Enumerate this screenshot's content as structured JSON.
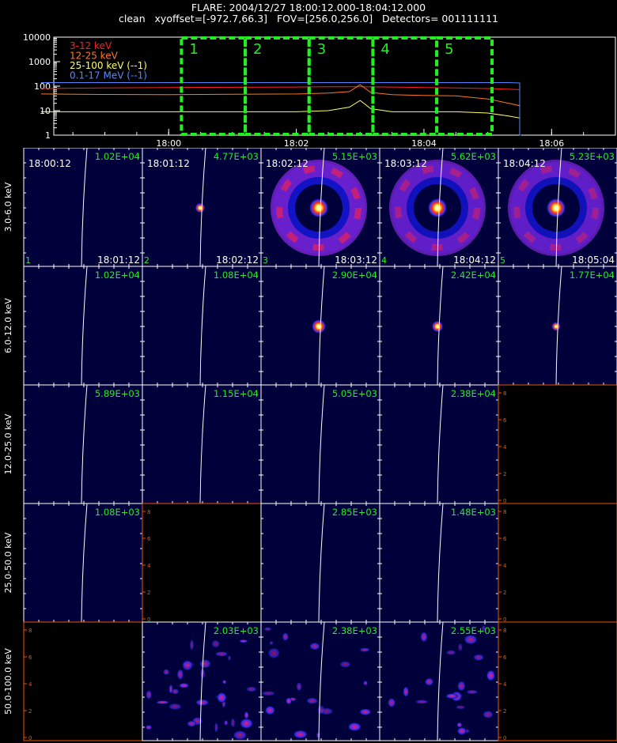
{
  "header": {
    "line1": "FLARE: 2004/12/27 18:00:12.000-18:04:12.000",
    "line2": "clean   xyoffset=[-972.7,66.3]   FOV=[256.0,256.0]   Detectors= 001111111"
  },
  "colors": {
    "bg": "#000000",
    "axis": "#ffffff",
    "green": "#22ee22",
    "orange_axis": "#ee5500",
    "red": "#ff2020",
    "orange": "#ff7722",
    "yellow": "#ffff66",
    "blue": "#5588ff",
    "panel_fill": "#00003a",
    "limb": "#ffffff"
  },
  "chart_data": [
    {
      "type": "line",
      "y_scale": "log",
      "ylim": [
        1,
        10000
      ],
      "y_ticks": [
        "10000",
        "1000",
        "100",
        "10",
        "1"
      ],
      "x_ticks": [
        "18:00",
        "18:02",
        "18:04",
        "18:06"
      ],
      "series": [
        {
          "name": "3-12 keV",
          "color": "#ff2020",
          "x": [
            "17:58:00",
            "17:59:00",
            "18:00:00",
            "18:01:00",
            "18:02:00",
            "18:02:30",
            "18:03:00",
            "18:03:30",
            "18:04:00",
            "18:04:30",
            "18:05:00",
            "18:05:20",
            "18:05:30"
          ],
          "values": [
            80,
            85,
            88,
            90,
            92,
            95,
            95,
            92,
            88,
            85,
            80,
            75,
            72
          ]
        },
        {
          "name": "12-25 keV",
          "color": "#ff7722",
          "x": [
            "17:58:00",
            "17:59:00",
            "18:00:00",
            "18:01:00",
            "18:02:00",
            "18:02:30",
            "18:02:50",
            "18:03:00",
            "18:03:10",
            "18:03:30",
            "18:04:00",
            "18:04:30",
            "18:05:00",
            "18:05:20",
            "18:05:30"
          ],
          "values": [
            48,
            46,
            45,
            47,
            48,
            52,
            60,
            115,
            55,
            45,
            42,
            40,
            30,
            20,
            16
          ]
        },
        {
          "name": "25-100 keV (--1)",
          "color": "#ffff66",
          "x": [
            "17:58:00",
            "17:59:00",
            "18:00:00",
            "18:01:00",
            "18:02:00",
            "18:02:30",
            "18:02:50",
            "18:03:00",
            "18:03:10",
            "18:03:30",
            "18:04:00",
            "18:04:30",
            "18:05:00",
            "18:05:20",
            "18:05:30"
          ],
          "values": [
            9,
            9,
            9,
            9,
            9,
            10,
            14,
            26,
            12,
            9,
            9,
            9,
            8,
            6,
            5
          ]
        },
        {
          "name": "0.1-17 MeV (--1)",
          "color": "#5588ff",
          "x": [
            "17:58:00",
            "17:59:00",
            "18:00:00",
            "18:01:00",
            "18:02:00",
            "18:03:00",
            "18:04:00",
            "18:05:00",
            "18:05:20",
            "18:05:30"
          ],
          "values": [
            140,
            140,
            140,
            140,
            140,
            140,
            140,
            140,
            140,
            135
          ]
        }
      ],
      "intervals": [
        {
          "label": "1",
          "start": "18:00:12",
          "end": "18:01:12"
        },
        {
          "label": "2",
          "start": "18:01:12",
          "end": "18:02:12"
        },
        {
          "label": "3",
          "start": "18:02:12",
          "end": "18:03:12"
        },
        {
          "label": "4",
          "start": "18:03:12",
          "end": "18:04:12"
        },
        {
          "label": "5",
          "start": "18:04:12",
          "end": "18:05:04"
        }
      ]
    },
    {
      "type": "heatmap",
      "rows": [
        "3.0-6.0 keV",
        "6.0-12.0 keV",
        "12.0-25.0 keV",
        "25.0-50.0 keV",
        "50.0-100.0 keV"
      ],
      "columns": [
        {
          "label": "1",
          "start": "18:00:12",
          "end": "18:01:12"
        },
        {
          "label": "2",
          "start": "18:01:12",
          "end": "18:02:12"
        },
        {
          "label": "3",
          "start": "18:02:12",
          "end": "18:03:12"
        },
        {
          "label": "4",
          "start": "18:03:12",
          "end": "18:04:12"
        },
        {
          "label": "5",
          "start": "18:04:12",
          "end": "18:05:04"
        }
      ],
      "axis_ticks": [
        "0",
        "2",
        "4",
        "6",
        "8"
      ],
      "cells": [
        [
          {
            "max": "1.02E+04",
            "state": "empty"
          },
          {
            "max": "4.77E+03",
            "state": "point",
            "source_strength": 0.35
          },
          {
            "max": "5.15E+03",
            "state": "ring",
            "ring_strength": 0.6
          },
          {
            "max": "5.62E+03",
            "state": "ring",
            "ring_strength": 0.45
          },
          {
            "max": "5.23E+03",
            "state": "ring",
            "ring_strength": 0.4
          }
        ],
        [
          {
            "max": "1.02E+04",
            "state": "empty"
          },
          {
            "max": "1.08E+04",
            "state": "empty"
          },
          {
            "max": "2.90E+04",
            "state": "point",
            "source_strength": 0.8
          },
          {
            "max": "2.42E+04",
            "state": "point",
            "source_strength": 0.5
          },
          {
            "max": "1.77E+04",
            "state": "point",
            "source_strength": 0.25
          }
        ],
        [
          {
            "max": "5.89E+03",
            "state": "empty"
          },
          {
            "max": "1.15E+04",
            "state": "empty"
          },
          {
            "max": "5.05E+03",
            "state": "empty"
          },
          {
            "max": "2.38E+04",
            "state": "empty"
          },
          {
            "max": null,
            "state": "none"
          }
        ],
        [
          {
            "max": "1.08E+03",
            "state": "empty"
          },
          {
            "max": null,
            "state": "none"
          },
          {
            "max": "2.85E+03",
            "state": "empty"
          },
          {
            "max": "1.48E+03",
            "state": "empty"
          },
          {
            "max": null,
            "state": "none"
          }
        ],
        [
          {
            "max": null,
            "state": "none"
          },
          {
            "max": "2.03E+03",
            "state": "noise",
            "noise_strength": 0.8
          },
          {
            "max": "2.38E+03",
            "state": "noise",
            "noise_strength": 0.5
          },
          {
            "max": "2.55E+03",
            "state": "noise",
            "noise_strength": 0.5
          },
          {
            "max": null,
            "state": "none"
          }
        ]
      ]
    }
  ]
}
